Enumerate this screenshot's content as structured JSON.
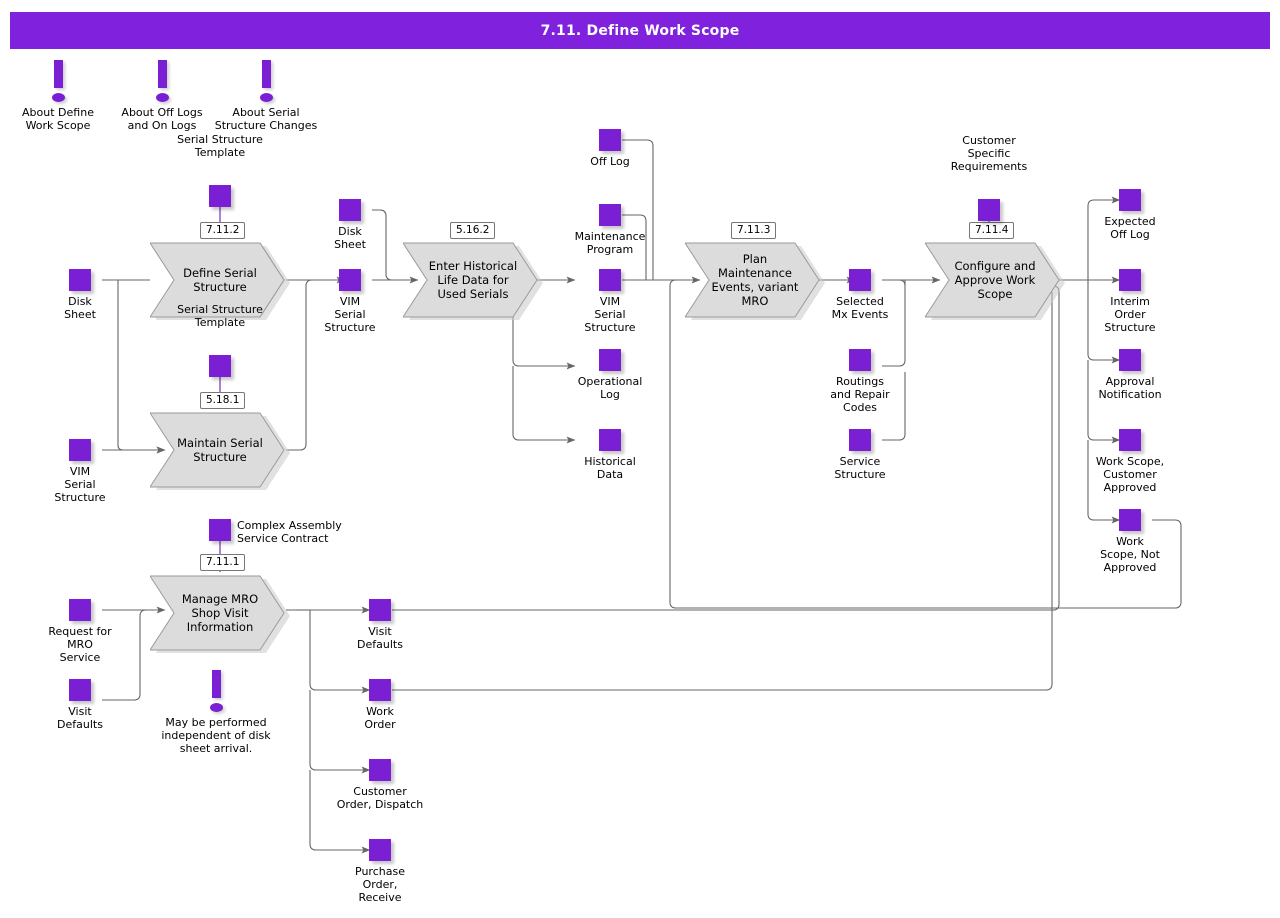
{
  "header": {
    "title": "7.11. Define Work Scope",
    "bar_color": "#8022dd"
  },
  "colors": {
    "node_fill": "#7a1fd4",
    "process_fill": "#dcdcdc",
    "process_stroke": "#9a9a9a",
    "wire": "#666666",
    "text": "#000000"
  },
  "info_markers": [
    {
      "id": "about-define-work-scope",
      "label": "About Define\nWork Scope"
    },
    {
      "id": "about-off-logs-and-on-logs",
      "label": "About Off Logs\nand On Logs"
    },
    {
      "id": "about-serial-structure-changes",
      "label": "About Serial\nStructure Changes"
    },
    {
      "id": "may-be-performed-independent",
      "label": "May be performed\nindependent of disk\nsheet arrival."
    }
  ],
  "processes": [
    {
      "id": "define-serial-structure",
      "label": "Define Serial\nStructure",
      "ref": "7.11.2"
    },
    {
      "id": "maintain-serial-structure",
      "label": "Maintain Serial\nStructure",
      "ref": "5.18.1"
    },
    {
      "id": "enter-historical-life-data",
      "label": "Enter Historical\nLife Data for\nUsed Serials",
      "ref": "5.16.2"
    },
    {
      "id": "plan-maintenance-events",
      "label": "Plan\nMaintenance\nEvents, variant\nMRO",
      "ref": "7.11.3"
    },
    {
      "id": "configure-approve-work-scope",
      "label": "Configure and\nApprove Work\nScope",
      "ref": "7.11.4"
    },
    {
      "id": "manage-mro-shop-visit",
      "label": "Manage MRO\nShop Visit\nInformation",
      "ref": "7.11.1"
    }
  ],
  "nodes": [
    {
      "id": "disk-sheet-in",
      "label": "Disk\nSheet"
    },
    {
      "id": "vim-serial-structure-in",
      "label": "VIM\nSerial\nStructure"
    },
    {
      "id": "serial-structure-template-1",
      "label": "Serial Structure\nTemplate"
    },
    {
      "id": "serial-structure-template-2",
      "label": "Serial Structure\nTemplate"
    },
    {
      "id": "disk-sheet-out",
      "label": "Disk\nSheet"
    },
    {
      "id": "vim-serial-structure-mid",
      "label": "VIM\nSerial\nStructure"
    },
    {
      "id": "off-log",
      "label": "Off Log"
    },
    {
      "id": "maintenance-program",
      "label": "Maintenance\nProgram"
    },
    {
      "id": "vim-serial-structure-out",
      "label": "VIM\nSerial\nStructure"
    },
    {
      "id": "operational-log",
      "label": "Operational\nLog"
    },
    {
      "id": "historical-data",
      "label": "Historical\nData"
    },
    {
      "id": "selected-mx-events",
      "label": "Selected\nMx Events"
    },
    {
      "id": "routings-and-repair-codes",
      "label": "Routings\nand  Repair\nCodes"
    },
    {
      "id": "service-structure",
      "label": "Service\nStructure"
    },
    {
      "id": "customer-specific-requirements",
      "label": "Customer\nSpecific\nRequirements"
    },
    {
      "id": "expected-off-log",
      "label": "Expected\nOff Log"
    },
    {
      "id": "interim-order-structure",
      "label": "Interim\nOrder\nStructure"
    },
    {
      "id": "approval-notification",
      "label": "Approval\nNotification"
    },
    {
      "id": "work-scope-customer-approved",
      "label": "Work Scope,\nCustomer\nApproved"
    },
    {
      "id": "work-scope-not-approved",
      "label": "Work\nScope, Not\nApproved"
    },
    {
      "id": "complex-assembly-service-contract",
      "label": "Complex Assembly\nService Contract"
    },
    {
      "id": "request-for-mro-service",
      "label": "Request for\nMRO\nService"
    },
    {
      "id": "visit-defaults-in",
      "label": "Visit\nDefaults"
    },
    {
      "id": "visit-defaults-out",
      "label": "Visit\nDefaults"
    },
    {
      "id": "work-order",
      "label": "Work\nOrder"
    },
    {
      "id": "customer-order-dispatch",
      "label": "Customer\nOrder, Dispatch"
    },
    {
      "id": "purchase-order-receive",
      "label": "Purchase\nOrder,\nReceive"
    }
  ]
}
